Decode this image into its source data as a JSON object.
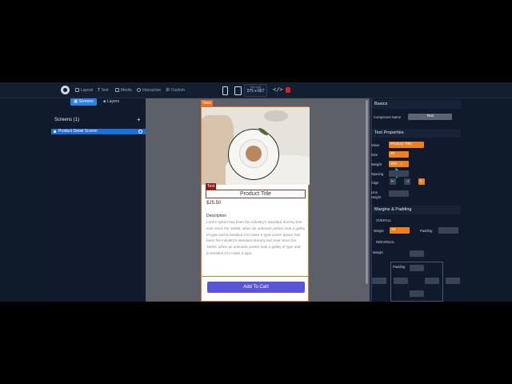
{
  "toolbar": {
    "items": [
      {
        "label": "Layout",
        "icon": "layout-icon"
      },
      {
        "label": "Text",
        "icon": "text-icon"
      },
      {
        "label": "Media",
        "icon": "media-icon"
      },
      {
        "label": "Interactive",
        "icon": "interactive-icon"
      },
      {
        "label": "Custom",
        "icon": "custom-icon"
      }
    ],
    "size_label": "Size (px)",
    "size_value": "375 x 667",
    "code_symbol": "</>"
  },
  "left": {
    "tabs": [
      {
        "label": "Screens",
        "active": true
      },
      {
        "label": "Layers",
        "active": false
      }
    ],
    "section_title": "Screens (1)",
    "add_symbol": "+",
    "screens": [
      {
        "label": "Product Detail Screen"
      }
    ]
  },
  "canvas": {
    "view_tag": "View",
    "text_tag": "Text",
    "product_title": "Product Title",
    "price": "$25.50",
    "description_heading": "Description",
    "description_body": "Lorem Ipsum has been the industry's standard dummy text ever since the 1500s, when an unknown printer took a galley of type and scrambled it to make a type.Lorem Ipsum has been the industry's standard dummy text ever since the 1500s, when an unknown printer took a galley of type and scrambled it to make a type.",
    "cart_button": "Add To Cart"
  },
  "right": {
    "basics_heading": "Basics",
    "component_name_label": "Component Name",
    "component_name_value": "Text",
    "text_props_heading": "Text Properties",
    "value_label": "Value",
    "value": "Product Title",
    "size_label": "Size",
    "size": "20",
    "weight_label": "Weight",
    "weight": "200",
    "spacing_label": "Spacing",
    "align_label": "Align",
    "line_height_label": "Line Height",
    "margins_heading": "Margins & Padding",
    "overall_label": "OVERALL",
    "margin_label": "Margin",
    "margin_value": "16",
    "padding_label": "Padding",
    "individual_label": "INDIVIDUAL",
    "ind_margin_label": "Margin",
    "ind_padding_label": "Padding"
  },
  "colors": {
    "accent": "#f07f1e",
    "primary_blue": "#2e7fe0",
    "cart_button": "#5a55d6",
    "selection_red": "#b02a2a"
  }
}
